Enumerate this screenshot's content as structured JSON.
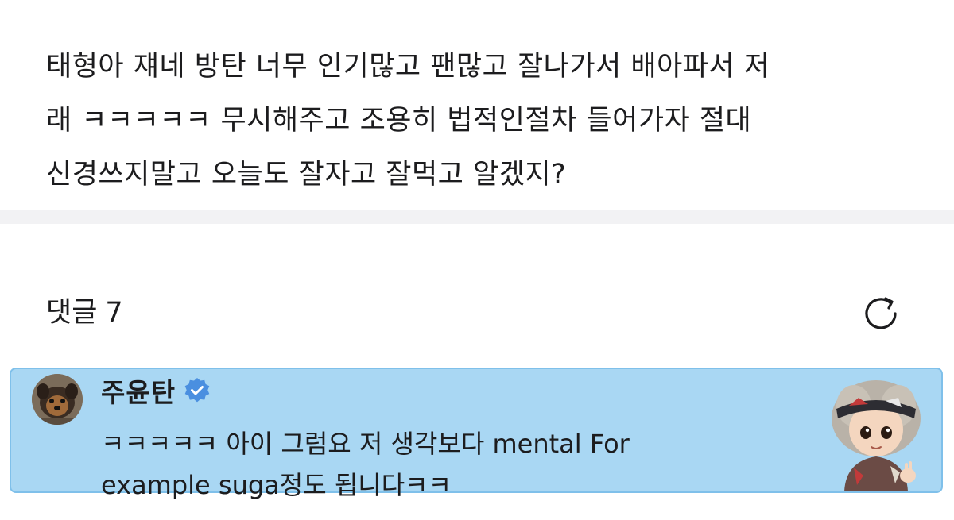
{
  "post": {
    "line1": "태형아 쟤네 방탄 너무 인기많고 팬많고 잘나가서 배아파서 저",
    "line2": "래 ㅋㅋㅋㅋㅋ 무시해주고 조용히 법적인절차 들어가자 절대",
    "line3": "신경쓰지말고 오늘도 잘자고 잘먹고 알겠지?"
  },
  "comments": {
    "title": "댓글",
    "count": "7",
    "refresh_icon": "refresh-icon"
  },
  "comment": {
    "author": "주윤탄",
    "verified_icon": "verified-badge-icon",
    "text_line1": "ㅋㅋㅋㅋㅋ 아이 그럼요 저 생각보다 mental For",
    "text_line2": "example suga정도 됩니다ㅋㅋ",
    "highlight_color": "#a9d7f3",
    "badge_color": "#4a8fe0"
  }
}
